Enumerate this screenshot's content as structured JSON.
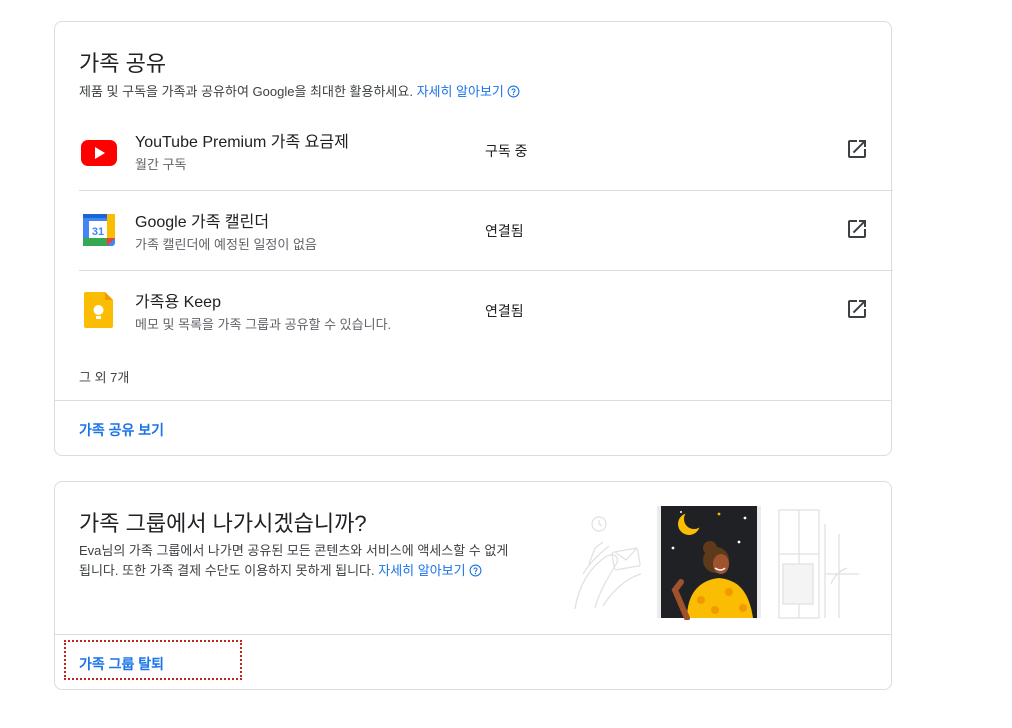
{
  "family_sharing": {
    "title": "가족 공유",
    "description": "제품 및 구독을 가족과 공유하여 Google을 최대한 활용하세요.",
    "learn_more": "자세히 알아보기",
    "services": [
      {
        "name": "YouTube Premium 가족 요금제",
        "sub": "월간 구독",
        "status": "구독 중",
        "icon": "youtube-icon"
      },
      {
        "name": "Google 가족 캘린더",
        "sub": "가족 캘린더에 예정된 일정이 없음",
        "status": "연결됨",
        "icon": "calendar-icon",
        "calendar_day": "31"
      },
      {
        "name": "가족용 Keep",
        "sub": "메모 및 목록을 가족 그룹과 공유할 수 있습니다.",
        "status": "연결됨",
        "icon": "keep-icon"
      }
    ],
    "more_text": "그 외 7개",
    "view_link": "가족 공유 보기"
  },
  "leave_group": {
    "title": "가족 그룹에서 나가시겠습니까?",
    "description_line1": "Eva님의 가족 그룹에서 나가면 공유된 모든 콘텐츠와 서비스에 액세스할 수 없게",
    "description_line2": "됩니다. 또한 가족 결제 수단도 이용하지 못하게 됩니다.",
    "learn_more": "자세히 알아보기",
    "leave_link": "가족 그룹 탈퇴"
  },
  "colors": {
    "link": "#1a73e8",
    "border": "#dadce0",
    "highlight": "#c5221f"
  }
}
